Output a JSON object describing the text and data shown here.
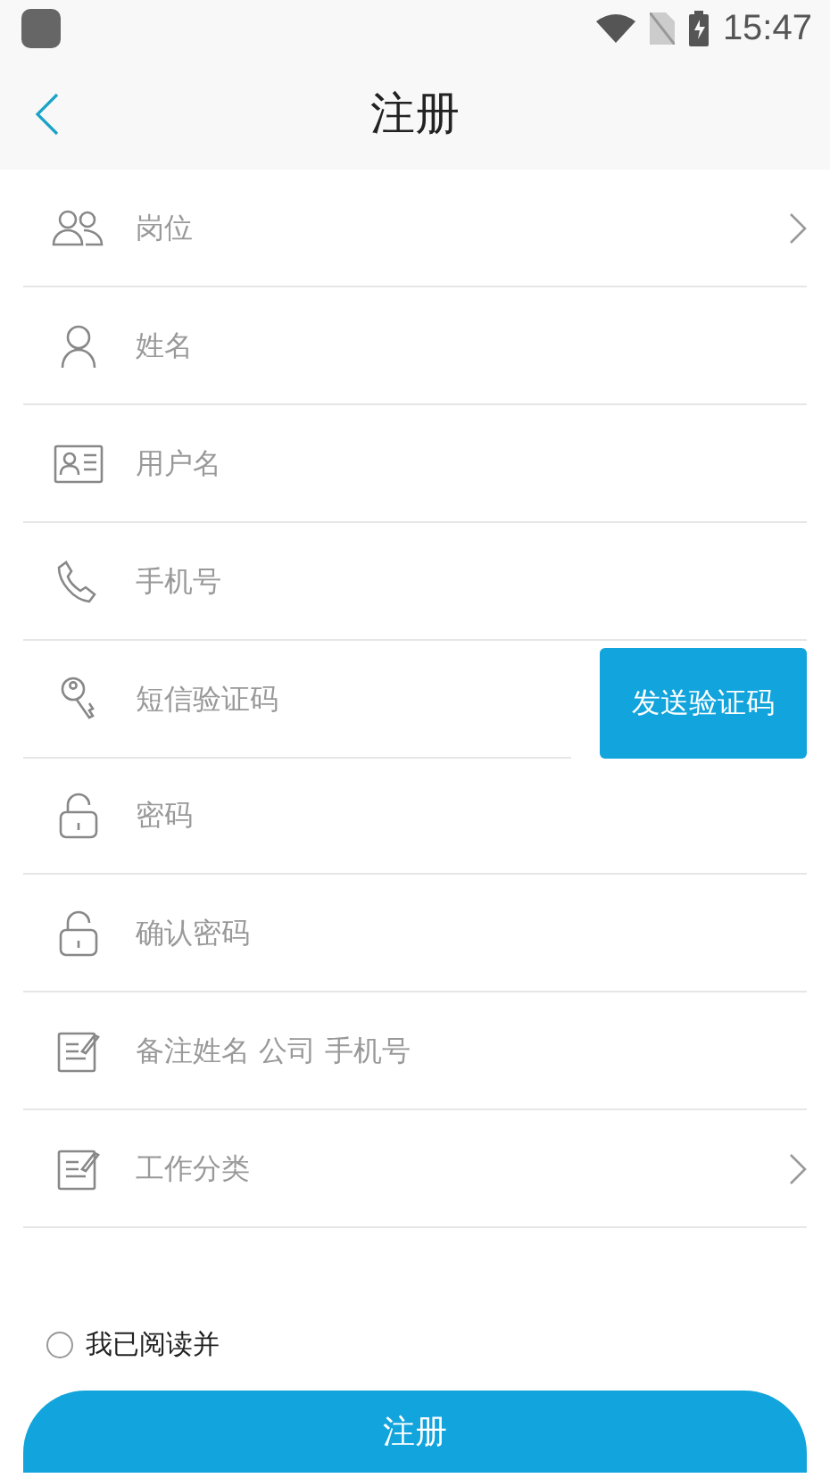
{
  "status_bar": {
    "time": "15:47"
  },
  "header": {
    "title": "注册"
  },
  "fields": [
    {
      "kind": "select",
      "placeholder": "岗位"
    },
    {
      "kind": "input",
      "placeholder": "姓名"
    },
    {
      "kind": "input",
      "placeholder": "用户名"
    },
    {
      "kind": "input",
      "placeholder": "手机号"
    },
    {
      "kind": "code",
      "placeholder": "短信验证码",
      "button": "发送验证码"
    },
    {
      "kind": "input",
      "placeholder": "密码"
    },
    {
      "kind": "input",
      "placeholder": "确认密码"
    },
    {
      "kind": "input",
      "placeholder": "备注姓名 公司 手机号"
    },
    {
      "kind": "select",
      "placeholder": "工作分类"
    }
  ],
  "agreement": {
    "checked": false,
    "text": "我已阅读并"
  },
  "submit": "注册"
}
